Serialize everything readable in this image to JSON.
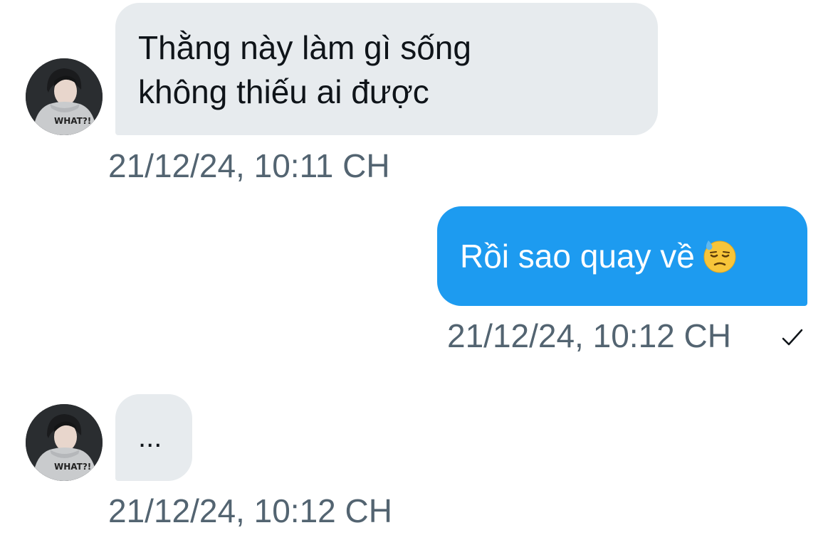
{
  "messages": [
    {
      "direction": "incoming",
      "lines": [
        "Thằng này làm gì sống",
        "không thiếu ai được"
      ],
      "timestamp": "21/12/24, 10:11 CH"
    },
    {
      "direction": "outgoing",
      "text": "Rồi sao quay về",
      "emoji": "downcast-face-with-sweat",
      "timestamp": "21/12/24, 10:12 CH",
      "status_icon": "check-icon"
    },
    {
      "direction": "incoming",
      "text": "...",
      "timestamp": "21/12/24, 10:12 CH"
    }
  ],
  "avatar": {
    "shirt_text": "WHAT?!"
  },
  "colors": {
    "incoming_bubble": "#e7ebee",
    "outgoing_bubble": "#1d9bf0",
    "timestamp": "#536471",
    "text": "#0f1419"
  }
}
